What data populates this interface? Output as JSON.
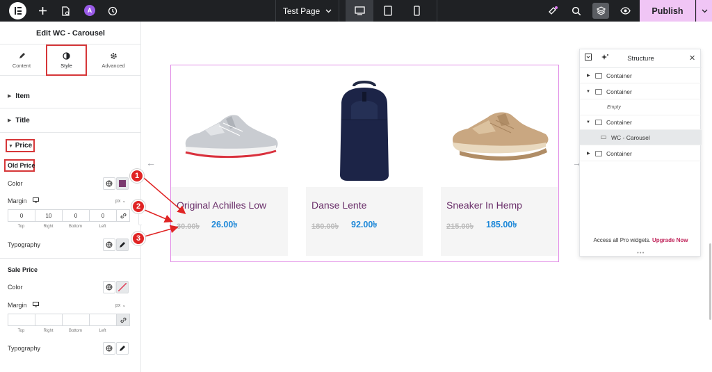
{
  "topbar": {
    "page_name": "Test Page",
    "publish_label": "Publish",
    "ai_badge": "A",
    "icons": [
      "elementor-logo-icon",
      "plus-icon",
      "page-settings-icon",
      "ai-icon",
      "history-icon",
      "desktop-icon",
      "tablet-icon",
      "mobile-icon",
      "notifications-icon",
      "search-icon",
      "structure-icon",
      "preview-icon",
      "chevron-down-icon"
    ]
  },
  "panel": {
    "title": "Edit WC - Carousel",
    "tabs": [
      {
        "label": "Content",
        "icon": "pencil-icon"
      },
      {
        "label": "Style",
        "icon": "contrast-icon"
      },
      {
        "label": "Advanced",
        "icon": "gear-icon"
      }
    ],
    "sections": {
      "item": "Item",
      "title": "Title",
      "price": "Price"
    },
    "old_price": {
      "heading": "Old Price",
      "color_label": "Color",
      "color_value": "#7b3a6f",
      "margin_label": "Margin",
      "unit": "px",
      "margin_values": [
        "0",
        "10",
        "0",
        "0"
      ],
      "dim_labels": [
        "Top",
        "Right",
        "Bottom",
        "Left"
      ],
      "typography_label": "Typography"
    },
    "sale_price": {
      "heading": "Sale Price",
      "color_label": "Color",
      "margin_label": "Margin",
      "unit": "px",
      "margin_values": [
        "",
        "",
        "",
        ""
      ],
      "dim_labels": [
        "Top",
        "Right",
        "Bottom",
        "Left"
      ],
      "typography_label": "Typography"
    }
  },
  "products": [
    {
      "name": "Original Achilles Low",
      "old_price": "30.00৳",
      "price": "26.00৳",
      "image": "sneaker-white-icon"
    },
    {
      "name": "Danse Lente",
      "old_price": "180.00৳",
      "price": "92.00৳",
      "image": "backpack-icon"
    },
    {
      "name": "Sneaker In Hemp",
      "old_price": "215.00৳",
      "price": "185.00৳",
      "image": "sneaker-tan-icon"
    }
  ],
  "markers": [
    "1",
    "2",
    "3"
  ],
  "structure": {
    "title": "Structure",
    "items": [
      {
        "label": "Container",
        "expanded": false
      },
      {
        "label": "Container",
        "expanded": true
      },
      {
        "label": "Empty"
      },
      {
        "label": "Container",
        "expanded": true
      },
      {
        "label": "WC - Carousel",
        "selected": true
      },
      {
        "label": "Container",
        "expanded": false
      }
    ],
    "footer_text": "Access all Pro widgets.",
    "footer_link": "Upgrade Now"
  },
  "colors": {
    "topbar": "#1f2124",
    "publish": "#f0c5f5",
    "highlight": "#d63638",
    "title_purple": "#6a2f6a",
    "price_blue": "#1e88d8",
    "carousel_border": "#e18ce6"
  }
}
